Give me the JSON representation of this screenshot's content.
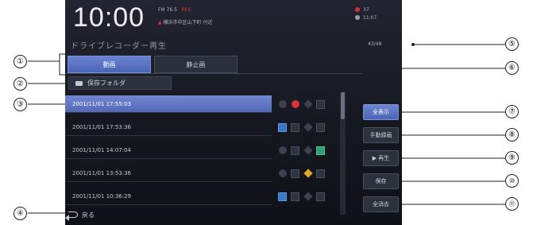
{
  "status": {
    "clock": "10:00",
    "top_small": "FM 76.5",
    "top_red": "REC",
    "location": "横浜市中区山下町 付近",
    "right_line1": "37",
    "right_line2": "11:07"
  },
  "page_title": "ドライブレコーダー再生",
  "count": "43/48",
  "tabs": [
    {
      "label": "動画"
    },
    {
      "label": "静止画"
    }
  ],
  "folder_button": {
    "label": "保存フォルダ",
    "icon": "folder-icon"
  },
  "list": [
    {
      "datetime": "2001/11/01  17:55:03"
    },
    {
      "datetime": "2001/11/01  17:53:36"
    },
    {
      "datetime": "2001/11/01  14:07:04"
    },
    {
      "datetime": "2001/11/01  13:53:36"
    },
    {
      "datetime": "2001/11/01  10:36:29"
    }
  ],
  "side_buttons": [
    {
      "label": "全表示"
    },
    {
      "label": "手動録画"
    },
    {
      "label": "▶ 再生"
    },
    {
      "label": "保存"
    },
    {
      "label": "全消去"
    }
  ],
  "back": {
    "label": "戻る",
    "icon": "back-arrow-icon"
  },
  "callouts": [
    "①",
    "②",
    "③",
    "④",
    "⑤",
    "⑥",
    "⑦",
    "⑧",
    "⑨",
    "⑩",
    "⑪"
  ],
  "colors": {
    "accent_blue": "#5a70c0",
    "screen_bg": "#15171f",
    "indicator_red": "#d8343c",
    "indicator_yellow": "#e0a82a",
    "indicator_blue": "#3878c4",
    "indicator_green": "#30a070"
  }
}
